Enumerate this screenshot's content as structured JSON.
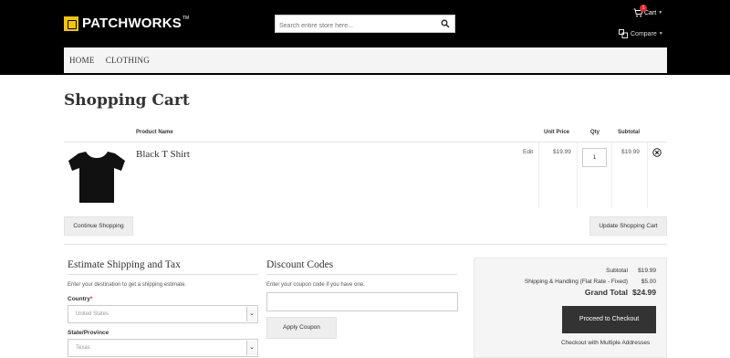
{
  "header": {
    "logo_text": "PATCHWORKS",
    "logo_tm": "TM",
    "search_placeholder": "Search entire store here...",
    "cart_label": "Cart",
    "cart_count": "1",
    "compare_label": "Compare"
  },
  "nav": {
    "items": [
      "HOME",
      "CLOTHING"
    ]
  },
  "page": {
    "title": "Shopping Cart"
  },
  "cart_table": {
    "headers": {
      "product": "Product Name",
      "unit_price": "Unit Price",
      "qty": "Qty",
      "subtotal": "Subtotal"
    },
    "items": [
      {
        "name": "Black T Shirt",
        "edit": "Edit",
        "unit_price": "$19.99",
        "qty": "1",
        "subtotal": "$19.99",
        "image_icon": "tshirt-icon"
      }
    ]
  },
  "actions": {
    "continue": "Continue Shopping",
    "update": "Update Shopping Cart"
  },
  "shipping": {
    "title": "Estimate Shipping and Tax",
    "hint": "Enter your destination to get a shipping estimate.",
    "country_label": "Country",
    "country_value": "United States",
    "state_label": "State/Province",
    "state_value": "Texas"
  },
  "discount": {
    "title": "Discount Codes",
    "hint": "Enter your coupon code if you have one.",
    "apply": "Apply Coupon"
  },
  "summary": {
    "subtotal_label": "Subtotal",
    "subtotal_value": "$19.99",
    "shipping_label": "Shipping & Handling (Flat Rate - Fixed)",
    "shipping_value": "$5.00",
    "grand_label": "Grand Total",
    "grand_value": "$24.99",
    "checkout": "Proceed to Checkout",
    "multi": "Checkout with Multiple Addresses"
  },
  "colors": {
    "header_bg": "#000000",
    "logo_accent": "#f2c500",
    "badge": "#e02b27",
    "checkout_bg": "#333333"
  }
}
